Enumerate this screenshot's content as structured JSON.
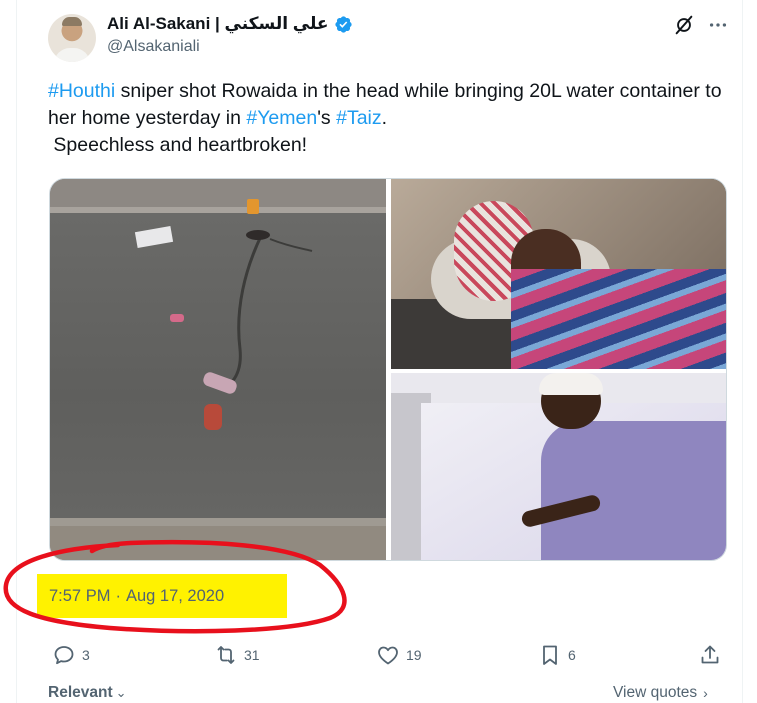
{
  "tweet": {
    "display_name": "Ali Al-Sakani | علي السكني",
    "handle": "@Alsakaniali",
    "text_parts": [
      {
        "t": "#Houthi",
        "tag": true
      },
      {
        "t": " sniper shot Rowaida in the head while bringing 20L water container to her home yesterday in ",
        "tag": false
      },
      {
        "t": "#Yemen",
        "tag": true
      },
      {
        "t": "'s ",
        "tag": false
      },
      {
        "t": "#Taiz",
        "tag": true
      },
      {
        "t": ".\n Speechless and heartbroken!",
        "tag": false
      }
    ],
    "timestamp_time": "7:57 PM",
    "timestamp_sep": "·",
    "timestamp_date": "Aug 17, 2020"
  },
  "actions": {
    "replies": "3",
    "reposts": "31",
    "likes": "19",
    "bookmarks": "6"
  },
  "footer": {
    "sort_label": "Relevant",
    "view_quotes_label": "View quotes"
  },
  "colors": {
    "accent": "#1d9bf0",
    "highlight": "#fff200",
    "annotation_circle": "#e8101c",
    "muted_text": "#536471"
  },
  "icons": [
    "verified-badge-icon",
    "grok-icon",
    "more-icon",
    "reply-icon",
    "repost-icon",
    "like-icon",
    "bookmark-icon",
    "share-icon",
    "chevron-down-icon",
    "chevron-right-icon"
  ]
}
